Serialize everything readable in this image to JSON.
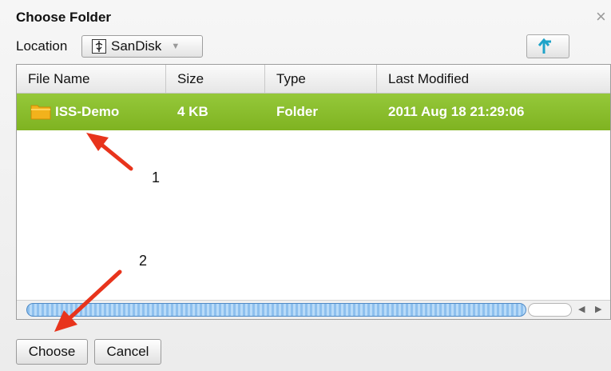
{
  "dialog": {
    "title": "Choose Folder",
    "close_glyph": "×",
    "location_label": "Location",
    "location_value": "SanDisk",
    "location_icon": "usb-drive-icon",
    "up_icon": "up-folder-arrow-icon"
  },
  "table": {
    "columns": [
      "File Name",
      "Size",
      "Type",
      "Last Modified"
    ],
    "rows": [
      {
        "name": "ISS-Demo",
        "size": "4 KB",
        "type": "Folder",
        "modified": "2011 Aug 18 21:29:06",
        "selected": true,
        "icon": "folder-icon"
      }
    ]
  },
  "buttons": {
    "choose": "Choose",
    "cancel": "Cancel"
  },
  "annotations": {
    "one": "1",
    "two": "2",
    "arrow_color": "#e8341c"
  },
  "colors": {
    "selected_row": "#88bd2c",
    "scroll_thumb": "#8ec0ee"
  }
}
